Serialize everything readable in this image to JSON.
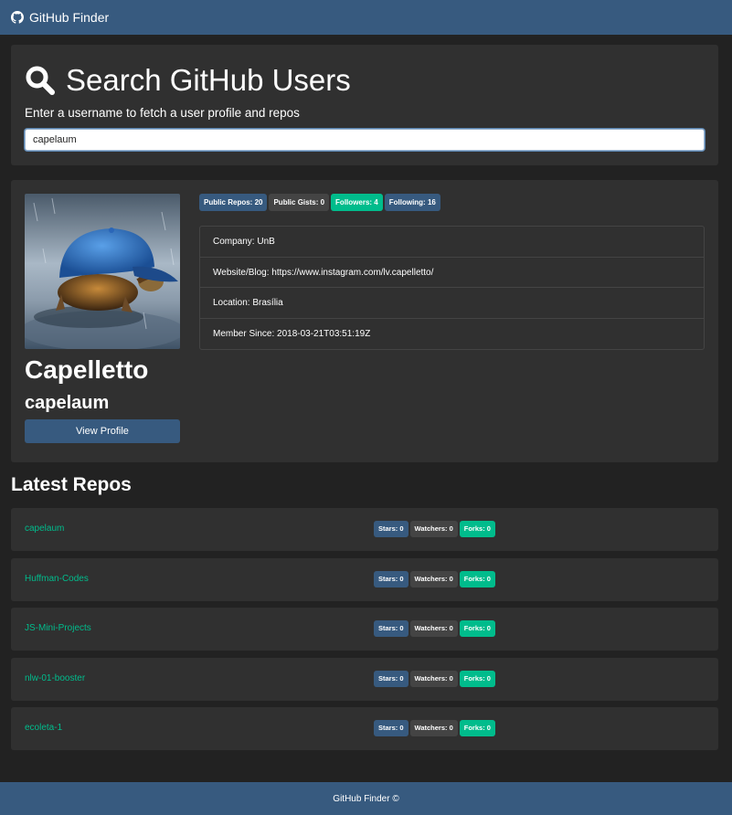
{
  "navbar": {
    "brand": "GitHub Finder",
    "icon": "github-icon"
  },
  "search": {
    "title": "Search GitHub Users",
    "subtitle": "Enter a username to fetch a user profile and repos",
    "value": "capelaum"
  },
  "profile": {
    "name": "Capelletto",
    "login": "capelaum",
    "view_button": "View Profile",
    "badges": {
      "public_repos": "Public Repos: 20",
      "public_gists": "Public Gists: 0",
      "followers": "Followers: 4",
      "following": "Following: 16"
    },
    "info": {
      "company": "Company: UnB",
      "website": "Website/Blog: https://www.instagram.com/lv.capelletto/",
      "location": "Location: Brasília",
      "member_since": "Member Since: 2018-03-21T03:51:19Z"
    }
  },
  "repos_title": "Latest Repos",
  "repos": [
    {
      "name": "capelaum",
      "stars": "Stars: 0",
      "watchers": "Watchers: 0",
      "forks": "Forks: 0"
    },
    {
      "name": "Huffman-Codes",
      "stars": "Stars: 0",
      "watchers": "Watchers: 0",
      "forks": "Forks: 0"
    },
    {
      "name": "JS-Mini-Projects",
      "stars": "Stars: 0",
      "watchers": "Watchers: 0",
      "forks": "Forks: 0"
    },
    {
      "name": "nlw-01-booster",
      "stars": "Stars: 0",
      "watchers": "Watchers: 0",
      "forks": "Forks: 0"
    },
    {
      "name": "ecoleta-1",
      "stars": "Stars: 0",
      "watchers": "Watchers: 0",
      "forks": "Forks: 0"
    }
  ],
  "footer": "GitHub Finder ©",
  "colors": {
    "primary": "#375a7f",
    "success": "#00bc8c",
    "secondary": "#444444",
    "background": "#222222",
    "card": "#303030"
  }
}
